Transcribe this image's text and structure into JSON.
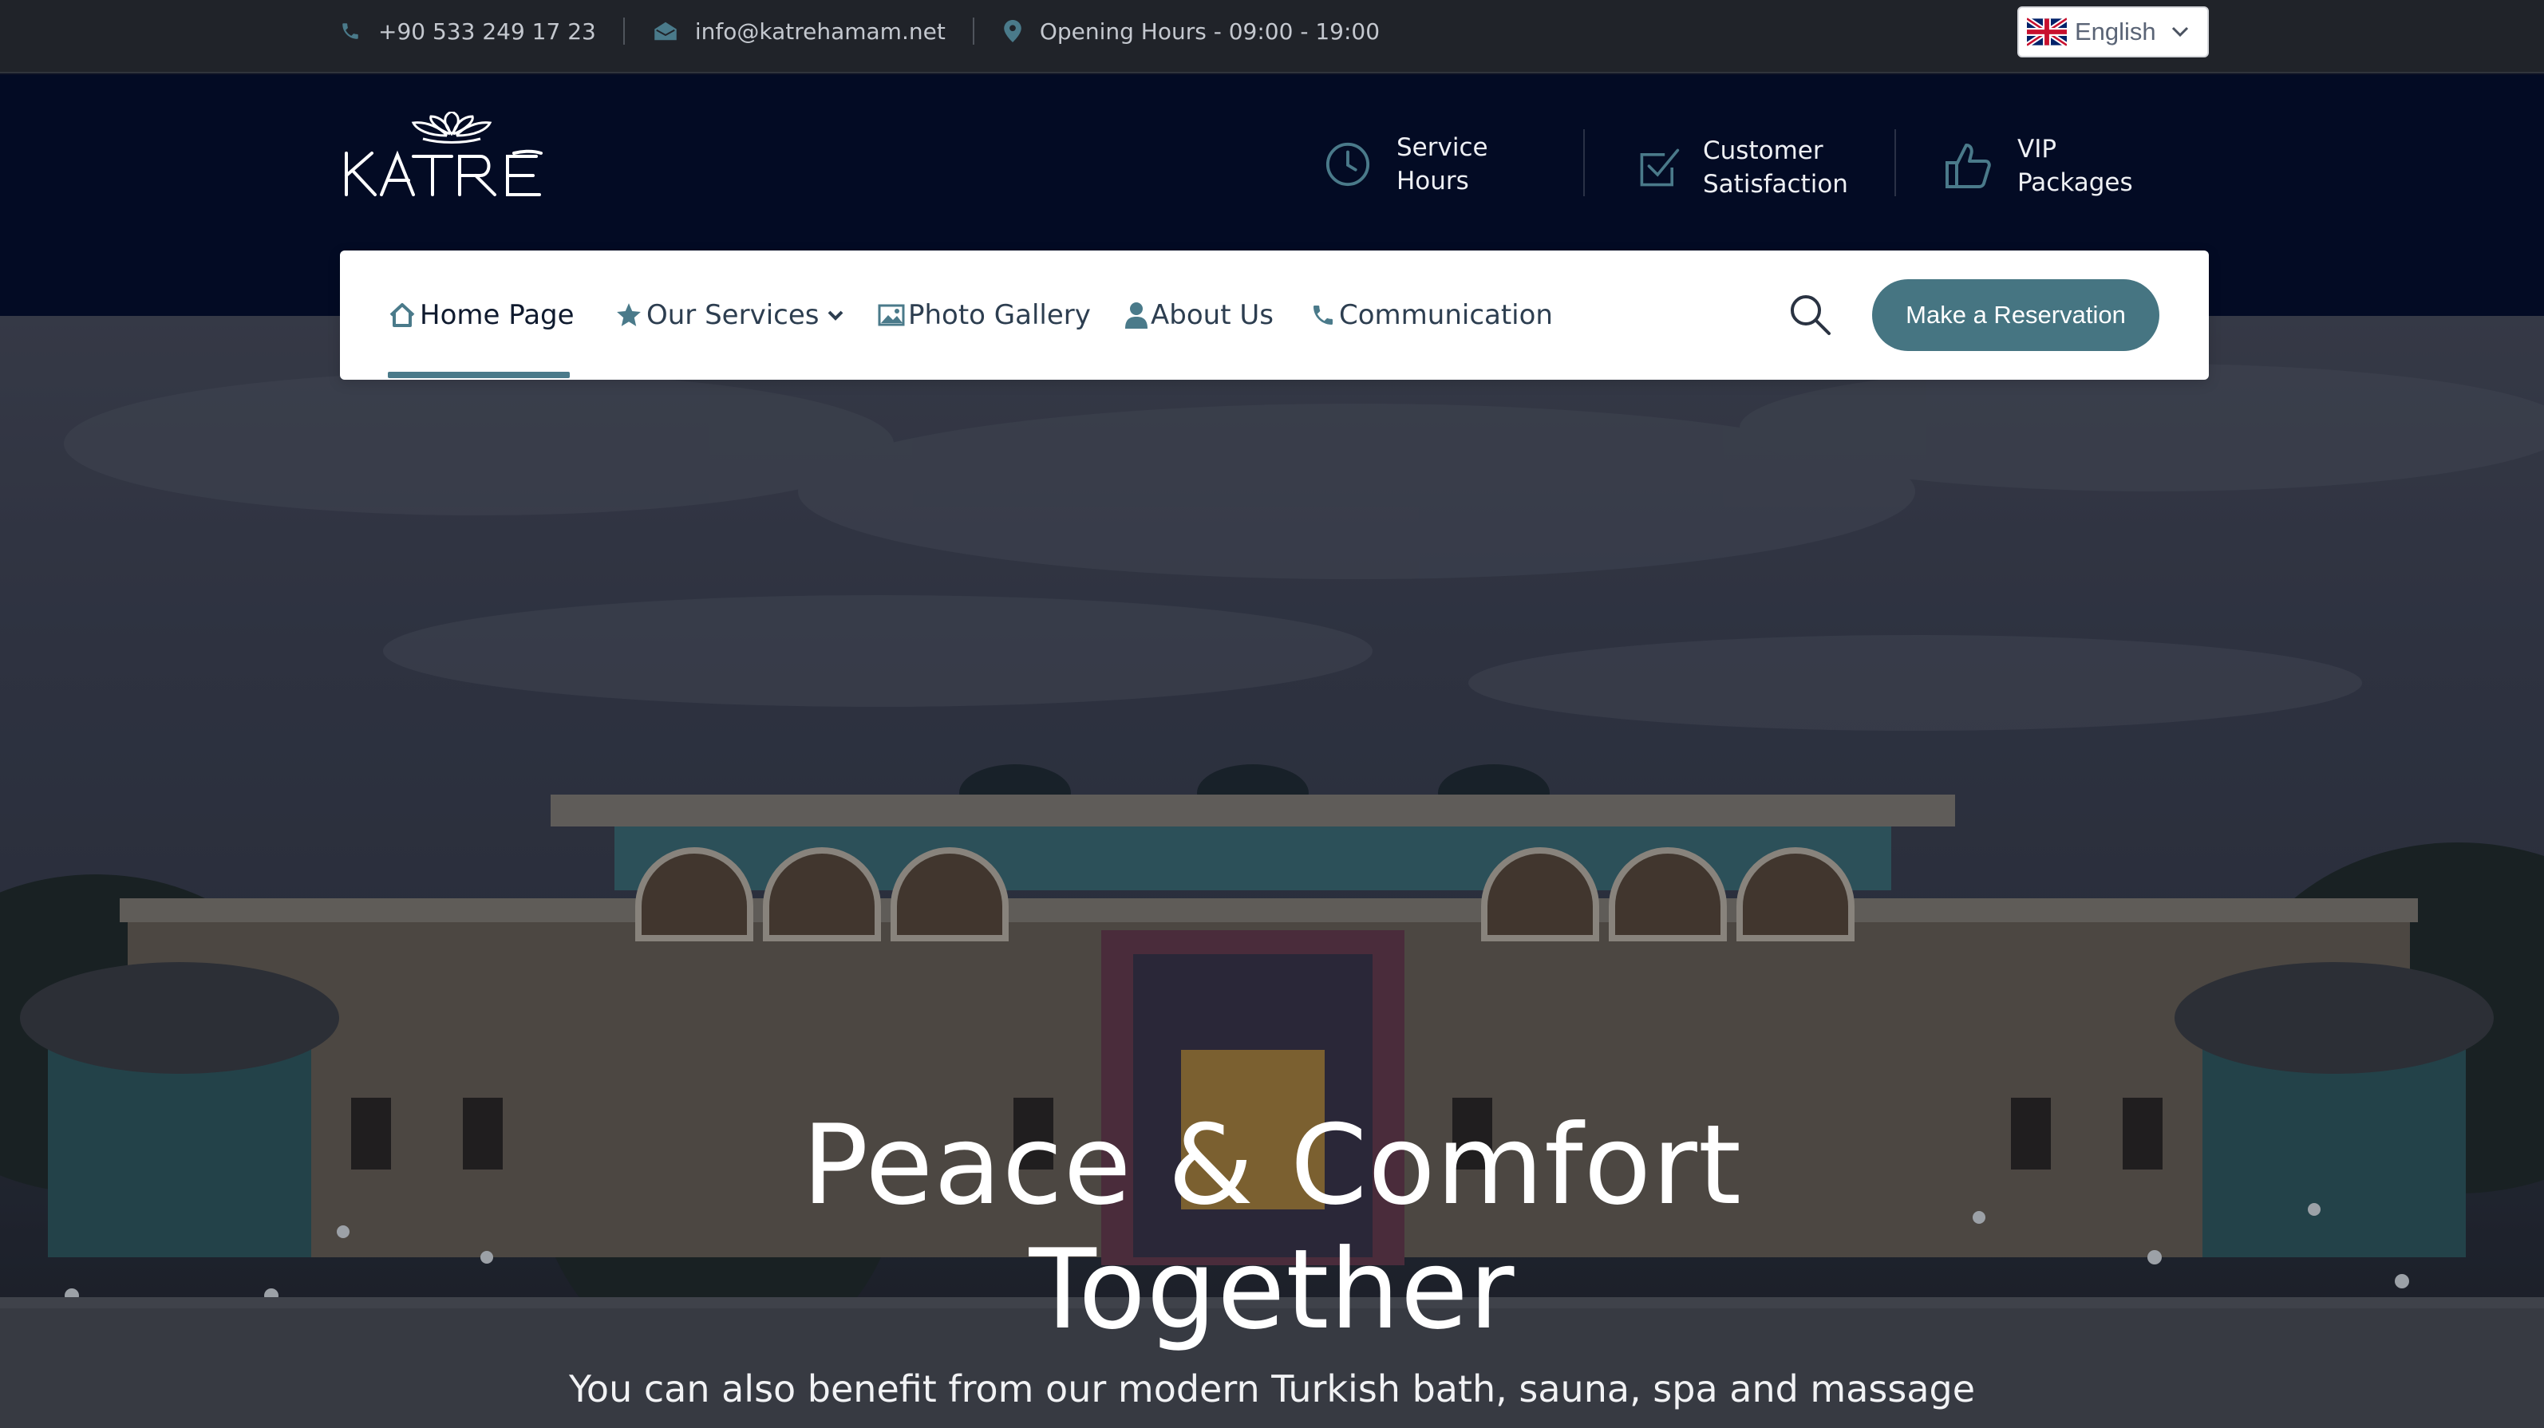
{
  "topbar": {
    "phone": "+90 533 249 17 23",
    "email": "info@katrehamam.net",
    "hours": "Opening Hours - 09:00 - 19:00",
    "language": {
      "label": "English",
      "flag": "uk-flag-icon"
    }
  },
  "header": {
    "logo_text": "KATRE",
    "features": [
      {
        "icon": "clock-icon",
        "line1": "Service",
        "line2": "Hours"
      },
      {
        "icon": "checkbox-icon",
        "line1": "Customer",
        "line2": "Satisfaction"
      },
      {
        "icon": "thumbs-up-icon",
        "line1": "VIP",
        "line2": "Packages"
      }
    ]
  },
  "nav": {
    "items": [
      {
        "label": "Home Page",
        "icon": "home-icon",
        "active": true
      },
      {
        "label": "Our Services",
        "icon": "star-icon",
        "dropdown": true
      },
      {
        "label": "Photo Gallery",
        "icon": "image-icon"
      },
      {
        "label": "About Us",
        "icon": "user-icon"
      },
      {
        "label": "Communication",
        "icon": "phone-icon"
      }
    ],
    "search_icon": "search-icon",
    "cta_label": "Make a Reservation"
  },
  "hero": {
    "title_line1": "Peace & Comfort",
    "title_line2": "Together",
    "subtitle": "You can also benefit from our modern Turkish bath, sauna, spa and massage"
  },
  "colors": {
    "topbar_bg": "#202329",
    "header_bg": "#030b24",
    "accent": "#467582",
    "icon_accent": "#4a7a8a"
  }
}
